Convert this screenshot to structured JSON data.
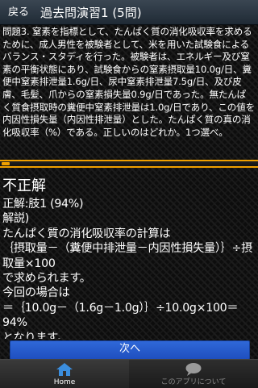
{
  "header": {
    "back_label": "戻る",
    "title": "過去問演習1 (5問)"
  },
  "question": {
    "text": "問題3. 窒素を指標として、たんぱく質の消化吸収率を求めるために、成人男性を被験者として、米を用いた試験食によるバランス・スタディを行った。被験者は、エネルギー及び窒素の平衡状態にあり、試験食からの窒素摂取量10.0g/日、糞便中窒素排泄量1.6g/日、尿中窒素排泄量7.5g/日、及び皮膚、毛髪、爪からの窒素損失量0.9g/日であった。無たんぱく質食摂取時の糞便中窒素排泄量は1.0g/日であり、この値を内因性損失量（内因性排泄量）とした。たんぱく質の真の消化吸収率（%）である。正しいのはどれか。1つ選べ。"
  },
  "answer": {
    "result": "不正解",
    "correct": "正解:肢1 (94%)",
    "explanation": "解説)\nたんぱく質の消化吸収率の計算は\n｛摂取量－（糞便中排泄量－内因性損失量）｝÷摂取量×100\nで求められます。\n今回の場合は\n＝｛10.0g－（1.6g－1.0g）｝÷10.0g×100＝94%\nとなります。"
  },
  "next_button": "次へ",
  "tabs": [
    {
      "label": "Home",
      "icon": "home-icon",
      "active": true
    },
    {
      "label": "このアプリについて",
      "icon": "chat-bubble-icon",
      "active": false
    }
  ],
  "colors": {
    "accent": "#f0a000",
    "button_blue": "#2a5fd0",
    "home_icon": "#3b8ede"
  }
}
